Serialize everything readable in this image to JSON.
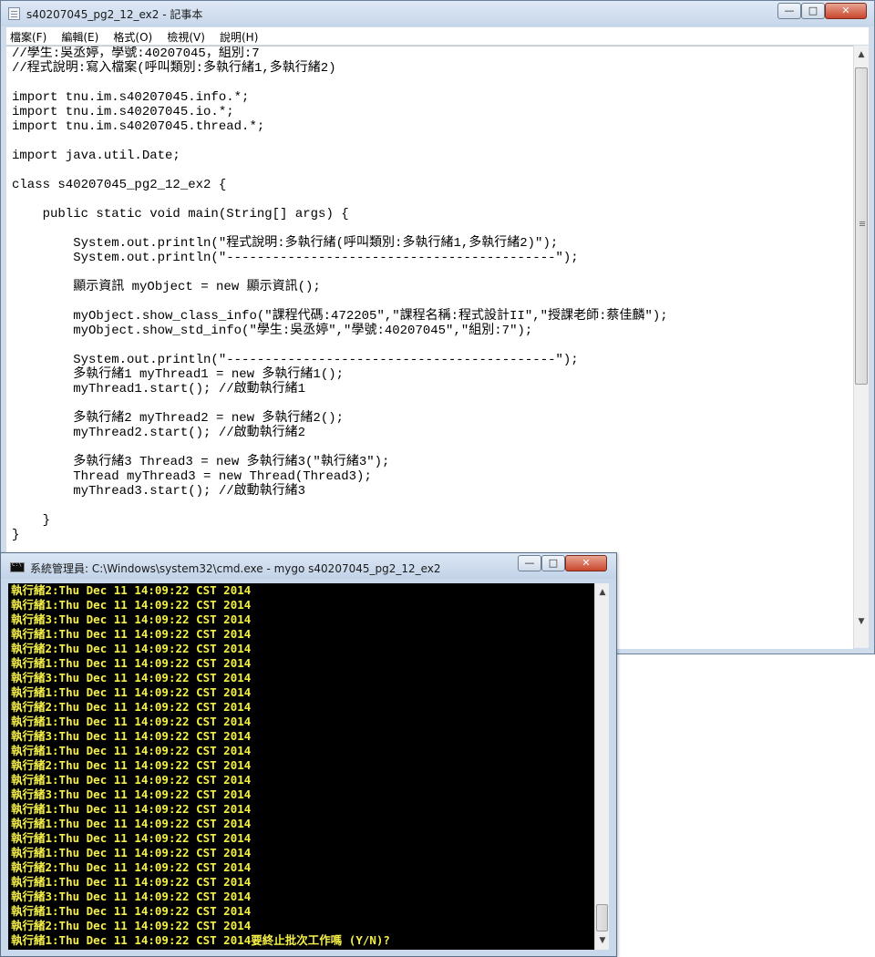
{
  "notepad": {
    "title": "s40207045_pg2_12_ex2 - 記事本",
    "buttons": {
      "minimize": "—",
      "maximize": "□",
      "close": "✕"
    },
    "menu": [
      "檔案(F)",
      "編輯(E)",
      "格式(O)",
      "檢視(V)",
      "說明(H)"
    ],
    "lines": [
      "//學生:吳丞婷，學號:40207045，組別:7",
      "//程式說明:寫入檔案(呼叫類別:多執行緒1,多執行緒2)",
      "",
      "import tnu.im.s40207045.info.*;",
      "import tnu.im.s40207045.io.*;",
      "import tnu.im.s40207045.thread.*;",
      "",
      "import java.util.Date;",
      "",
      "class s40207045_pg2_12_ex2 {",
      "",
      "    public static void main(String[] args) {",
      "",
      "        System.out.println(\"程式說明:多執行緒(呼叫類別:多執行緒1,多執行緒2)\");",
      "        System.out.println(\"-------------------------------------------\");",
      "",
      "        顯示資訊 myObject = new 顯示資訊();",
      "",
      "        myObject.show_class_info(\"課程代碼:472205\",\"課程名稱:程式設計II\",\"授課老師:蔡佳麟\");",
      "        myObject.show_std_info(\"學生:吳丞婷\",\"學號:40207045\",\"組別:7\");",
      "",
      "        System.out.println(\"-------------------------------------------\");",
      "        多執行緒1 myThread1 = new 多執行緒1();",
      "        myThread1.start(); //啟動執行緒1",
      "",
      "        多執行緒2 myThread2 = new 多執行緒2();",
      "        myThread2.start(); //啟動執行緒2",
      "",
      "        多執行緒3 Thread3 = new 多執行緒3(\"執行緒3\");",
      "        Thread myThread3 = new Thread(Thread3);",
      "        myThread3.start(); //啟動執行緒3",
      "",
      "    }",
      "}"
    ]
  },
  "console": {
    "title": "系統管理員: C:\\Windows\\system32\\cmd.exe - mygo  s40207045_pg2_12_ex2",
    "buttons": {
      "minimize": "—",
      "maximize": "□",
      "close": "✕"
    },
    "lines": [
      "執行緒2:Thu Dec 11 14:09:22 CST 2014",
      "執行緒1:Thu Dec 11 14:09:22 CST 2014",
      "執行緒3:Thu Dec 11 14:09:22 CST 2014",
      "執行緒1:Thu Dec 11 14:09:22 CST 2014",
      "執行緒2:Thu Dec 11 14:09:22 CST 2014",
      "執行緒1:Thu Dec 11 14:09:22 CST 2014",
      "執行緒3:Thu Dec 11 14:09:22 CST 2014",
      "執行緒1:Thu Dec 11 14:09:22 CST 2014",
      "執行緒2:Thu Dec 11 14:09:22 CST 2014",
      "執行緒1:Thu Dec 11 14:09:22 CST 2014",
      "執行緒3:Thu Dec 11 14:09:22 CST 2014",
      "執行緒1:Thu Dec 11 14:09:22 CST 2014",
      "執行緒2:Thu Dec 11 14:09:22 CST 2014",
      "執行緒1:Thu Dec 11 14:09:22 CST 2014",
      "執行緒3:Thu Dec 11 14:09:22 CST 2014",
      "執行緒1:Thu Dec 11 14:09:22 CST 2014",
      "執行緒1:Thu Dec 11 14:09:22 CST 2014",
      "執行緒1:Thu Dec 11 14:09:22 CST 2014",
      "執行緒1:Thu Dec 11 14:09:22 CST 2014",
      "執行緒2:Thu Dec 11 14:09:22 CST 2014",
      "執行緒1:Thu Dec 11 14:09:22 CST 2014",
      "執行緒3:Thu Dec 11 14:09:22 CST 2014",
      "執行緒1:Thu Dec 11 14:09:22 CST 2014",
      "執行緒2:Thu Dec 11 14:09:22 CST 2014",
      "執行緒1:Thu Dec 11 14:09:22 CST 2014要終止批次工作嗎 (Y/N)?"
    ]
  },
  "colors": {
    "console_text": "#f5f046",
    "console_background": "#000000",
    "close_button": "#c9462c"
  }
}
